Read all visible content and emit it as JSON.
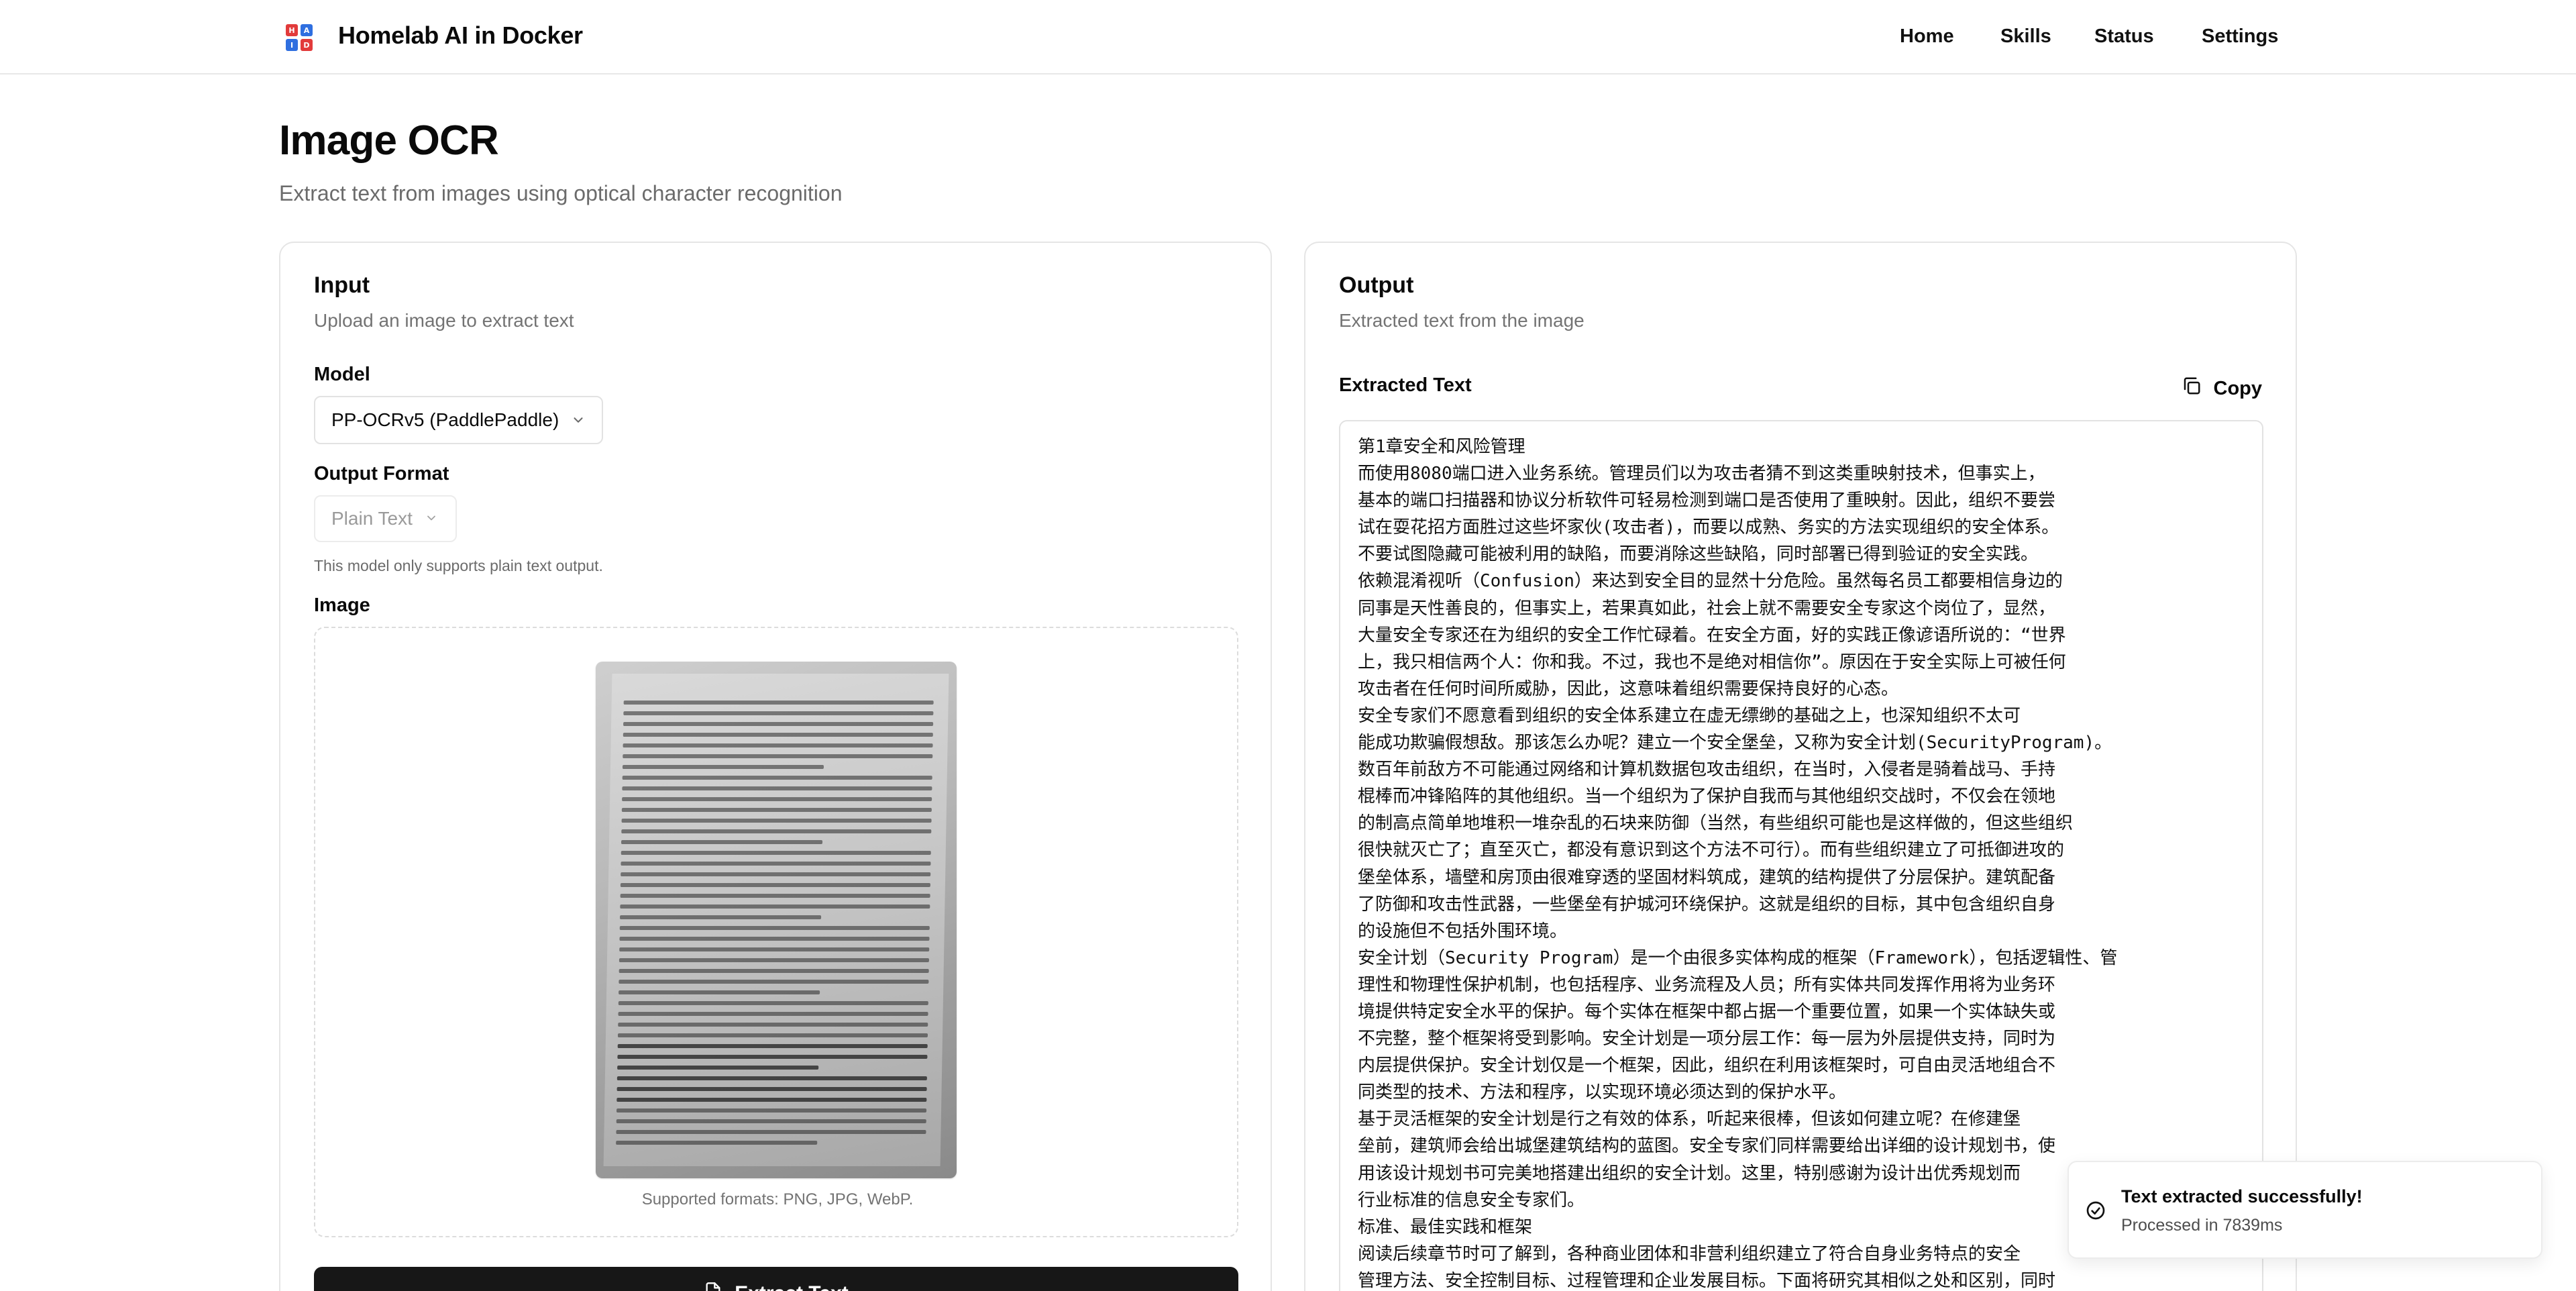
{
  "brand": {
    "title": "Homelab AI in Docker",
    "icon_letters": [
      "H",
      "A",
      "I",
      "D"
    ],
    "icon_colors": [
      "#e23b3b",
      "#2f6fe0",
      "#2f6fe0",
      "#e23b3b"
    ]
  },
  "nav": {
    "items": [
      {
        "label": "Home"
      },
      {
        "label": "Skills"
      },
      {
        "label": "Status"
      },
      {
        "label": "Settings"
      }
    ]
  },
  "page": {
    "title": "Image OCR",
    "subtitle": "Extract text from images using optical character recognition"
  },
  "input": {
    "title": "Input",
    "description": "Upload an image to extract text",
    "model_label": "Model",
    "model_value": "PP-OCRv5 (PaddlePaddle)",
    "format_label": "Output Format",
    "format_value": "Plain Text",
    "format_hint": "This model only supports plain text output.",
    "image_label": "Image",
    "supported_formats": "Supported formats: PNG, JPG, WebP.",
    "extract_button": "Extract Text"
  },
  "output": {
    "title": "Output",
    "description": "Extracted text from the image",
    "extracted_label": "Extracted Text",
    "copy_label": "Copy",
    "text": "第1章安全和风险管理\n而使用8080端口进入业务系统。管理员们以为攻击者猜不到这类重映射技术，但事实上，\n基本的端口扫描器和协议分析软件可轻易检测到端口是否使用了重映射。因此，组织不要尝\n试在耍花招方面胜过这些坏家伙(攻击者)，而要以成熟、务实的方法实现组织的安全体系。\n不要试图隐藏可能被利用的缺陷，而要消除这些缺陷，同时部署已得到验证的安全实践。\n依赖混淆视听（Confusion）来达到安全目的显然十分危险。虽然每名员工都要相信身边的\n同事是天性善良的，但事实上，若果真如此，社会上就不需要安全专家这个岗位了，显然，\n大量安全专家还在为组织的安全工作忙碌着。在安全方面，好的实践正像谚语所说的：“世界\n上，我只相信两个人：你和我。不过，我也不是绝对相信你”。原因在于安全实际上可被任何\n攻击者在任何时间所威胁，因此，这意味着组织需要保持良好的心态。\n安全专家们不愿意看到组织的安全体系建立在虚无缥缈的基础之上，也深知组织不太可\n能成功欺骗假想敌。那该怎么办呢？建立一个安全堡垒，又称为安全计划(SecurityProgram)。\n数百年前敌方不可能通过网络和计算机数据包攻击组织，在当时，入侵者是骑着战马、手持\n棍棒而冲锋陷阵的其他组织。当一个组织为了保护自我而与其他组织交战时，不仅会在领地\n的制高点简单地堆积一堆杂乱的石块来防御（当然，有些组织可能也是这样做的，但这些组织\n很快就灭亡了；直至灭亡，都没有意识到这个方法不可行）。而有些组织建立了可抵御进攻的\n堡垒体系，墙壁和房顶由很难穿透的坚固材料筑成，建筑的结构提供了分层保护。建筑配备\n了防御和攻击性武器，一些堡垒有护城河环绕保护。这就是组织的目标，其中包含组织自身\n的设施但不包括外围环境。\n安全计划（Security Program）是一个由很多实体构成的框架（Framework），包括逻辑性、管\n理性和物理性保护机制，也包括程序、业务流程及人员；所有实体共同发挥作用将为业务环\n境提供特定安全水平的保护。每个实体在框架中都占据一个重要位置，如果一个实体缺失或\n不完整，整个框架将受到影响。安全计划是一项分层工作：每一层为外层提供支持，同时为\n内层提供保护。安全计划仅是一个框架，因此，组织在利用该框架时，可自由灵活地组合不\n同类型的技术、方法和程序，以实现环境必须达到的保护水平。\n基于灵活框架的安全计划是行之有效的体系，听起来很棒，但该如何建立呢？在修建堡\n垒前，建筑师会给出城堡建筑结构的蓝图。安全专家们同样需要给出详细的设计规划书，使\n用该设计规划书可完美地搭建出组织的安全计划。这里，特别感谢为设计出优秀规划而\n行业标准的信息安全专家们。\n标准、最佳实践和框架\n阅读后续章节时可了解到，各种商业团体和非营利组织建立了符合自身业务特点的安全\n管理方法、安全控制目标、过程管理和企业发展目标。下面将研究其相似之处和区别，同时"
  },
  "toast": {
    "title": "Text extracted successfully!",
    "description": "Processed in 7839ms"
  }
}
